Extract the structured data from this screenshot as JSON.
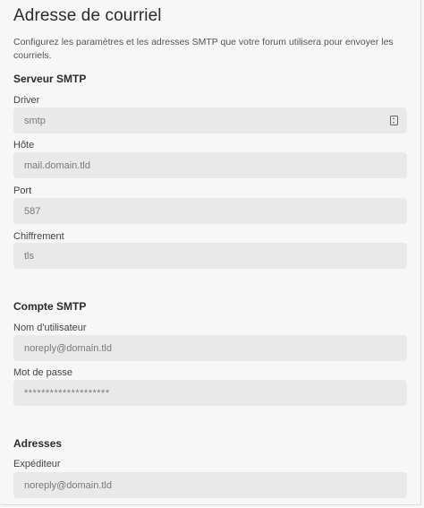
{
  "page": {
    "title": "Adresse de courriel",
    "description": "Configurez les paramètres et les adresses SMTP que votre forum utilisera pour envoyer les courriels."
  },
  "smtp_server": {
    "heading": "Serveur SMTP",
    "driver": {
      "label": "Driver",
      "value": "smtp",
      "icon": "select-arrows-icon"
    },
    "host": {
      "label": "Hôte",
      "placeholder": "mail.domain.tld"
    },
    "port": {
      "label": "Port",
      "placeholder": "587"
    },
    "encryption": {
      "label": "Chiffrement",
      "placeholder": "tls"
    }
  },
  "smtp_account": {
    "heading": "Compte SMTP",
    "username": {
      "label": "Nom d'utilisateur",
      "placeholder": "noreply@domain.tld"
    },
    "password": {
      "label": "Mot de passe",
      "value": "********************"
    }
  },
  "addresses": {
    "heading": "Adresses",
    "sender": {
      "label": "Expéditeur",
      "placeholder": "noreply@domain.tld"
    }
  }
}
